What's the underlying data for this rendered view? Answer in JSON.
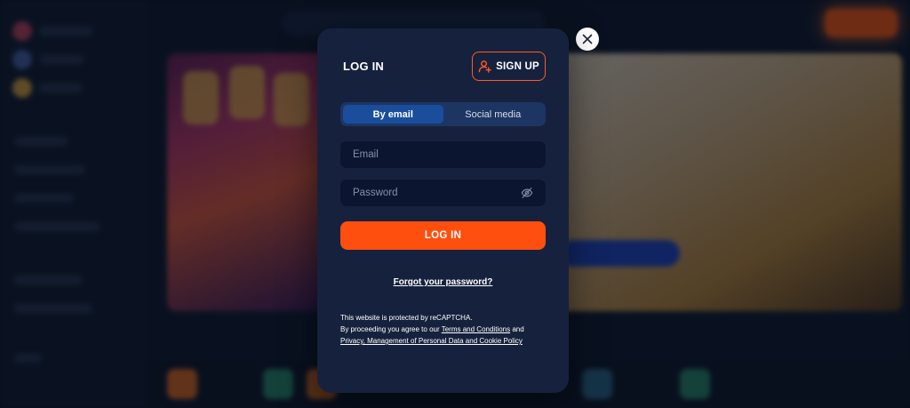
{
  "modal": {
    "title": "LOG IN",
    "signup_label": "SIGN UP",
    "tabs": [
      {
        "label": "By email",
        "active": true
      },
      {
        "label": "Social media",
        "active": false
      }
    ],
    "email": {
      "placeholder": "Email",
      "value": ""
    },
    "password": {
      "placeholder": "Password",
      "value": ""
    },
    "login_label": "LOG IN",
    "forgot_label": "Forgot your password?",
    "legal": {
      "line1": "This website is protected by reCAPTCHA.",
      "line2_prefix": "By proceeding you agree to our ",
      "terms_link": "Terms and Conditions",
      "line2_suffix": " and",
      "privacy_link": "Privacy, Management of Personal Data and Cookie Policy"
    }
  },
  "icons": {
    "close": "close-icon",
    "signup": "user-plus-icon",
    "password_toggle": "eye-off-icon"
  },
  "colors": {
    "modal_bg": "#16223d",
    "accent_orange": "#ff4f0f",
    "tab_active": "#1a4d9c",
    "tabs_bg": "#1d3562",
    "field_bg": "#0c1530"
  }
}
